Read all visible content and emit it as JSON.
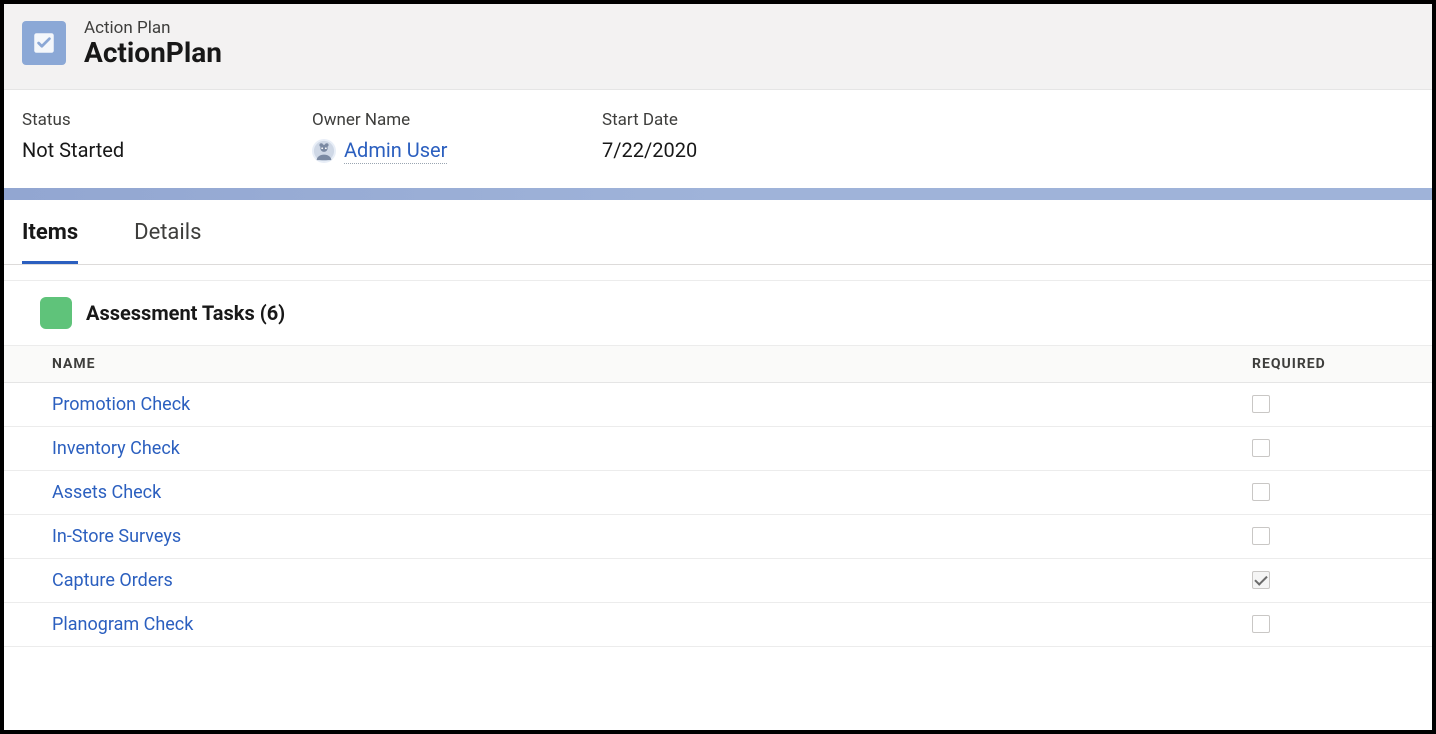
{
  "header": {
    "subtitle": "Action Plan",
    "title": "ActionPlan"
  },
  "fields": {
    "status_label": "Status",
    "status_value": "Not Started",
    "owner_label": "Owner Name",
    "owner_value": "Admin User",
    "startdate_label": "Start Date",
    "startdate_value": "7/22/2020"
  },
  "tabs": {
    "items": "Items",
    "details": "Details",
    "active": "items"
  },
  "section": {
    "title": "Assessment Tasks (6)"
  },
  "table": {
    "name_header": "NAME",
    "required_header": "REQUIRED",
    "rows": [
      {
        "name": "Promotion Check",
        "required": false
      },
      {
        "name": "Inventory Check",
        "required": false
      },
      {
        "name": "Assets Check",
        "required": false
      },
      {
        "name": "In-Store Surveys",
        "required": false
      },
      {
        "name": "Capture Orders",
        "required": true
      },
      {
        "name": "Planogram Check",
        "required": false
      }
    ]
  }
}
